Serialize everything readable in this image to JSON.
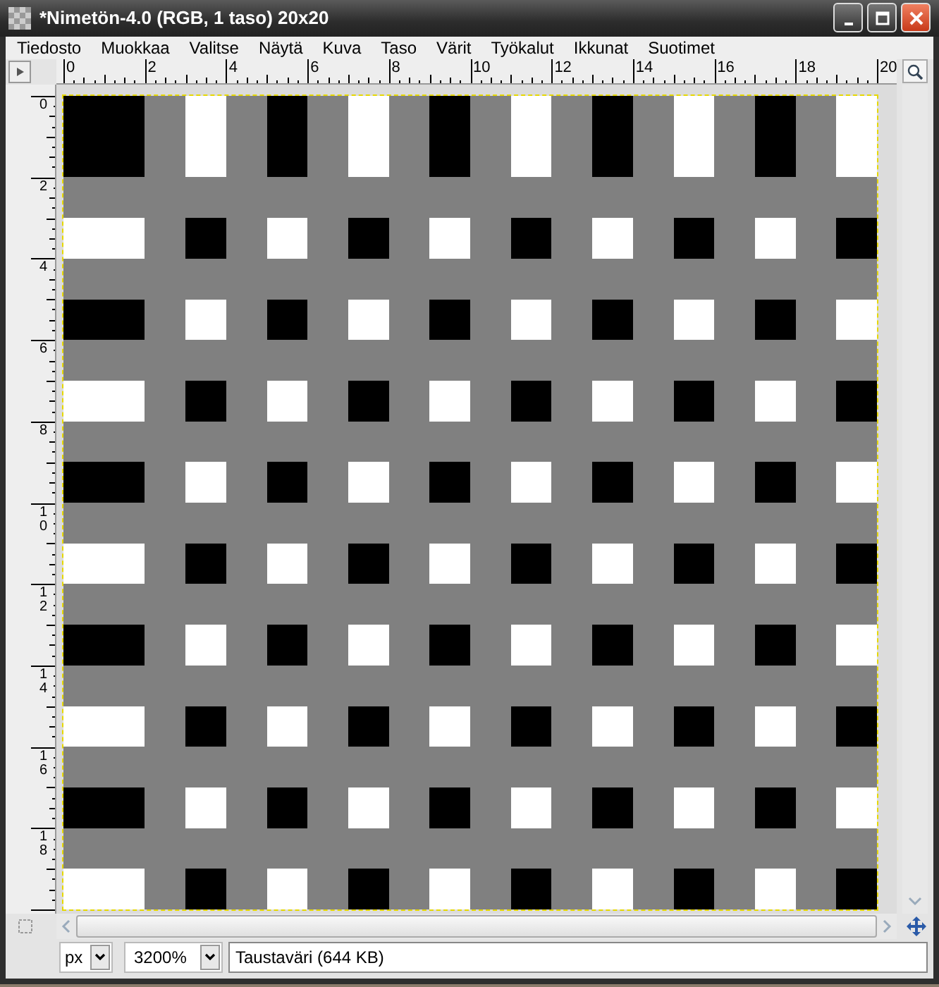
{
  "window": {
    "title": "*Nimetön-4.0 (RGB, 1 taso) 20x20"
  },
  "menu": [
    "Tiedosto",
    "Muokkaa",
    "Valitse",
    "Näytä",
    "Kuva",
    "Taso",
    "Värit",
    "Työkalut",
    "Ikkunat",
    "Suotimet"
  ],
  "ruler_horizontal": [
    "0",
    "2",
    "4",
    "6",
    "8",
    "10",
    "12",
    "14",
    "16",
    "18",
    "20"
  ],
  "ruler_vertical": [
    "0",
    "2",
    "4",
    "6",
    "8",
    "10",
    "12",
    "14",
    "16",
    "18"
  ],
  "status_bar": {
    "unit": "px",
    "zoom": "3200%",
    "message": "Taustaväri (644 KB)"
  }
}
